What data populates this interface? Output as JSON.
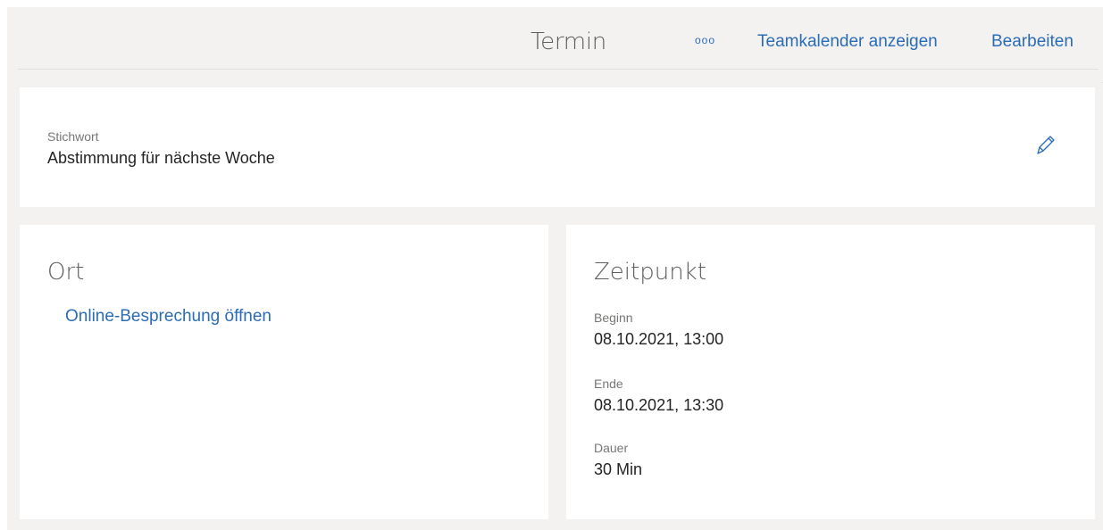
{
  "header": {
    "title": "Termin",
    "more_label": "ooo",
    "team_calendar_label": "Teamkalender anzeigen",
    "edit_label": "Bearbeiten"
  },
  "subject": {
    "label": "Stichwort",
    "value": "Abstimmung für nächste Woche",
    "edit_icon": "pencil-icon"
  },
  "place": {
    "title": "Ort",
    "online_meeting_link": "Online-Besprechung öffnen"
  },
  "time": {
    "title": "Zeitpunkt",
    "start": {
      "label": "Beginn",
      "value": "08.10.2021, 13:00"
    },
    "end": {
      "label": "Ende",
      "value": "08.10.2021, 13:30"
    },
    "duration": {
      "label": "Dauer",
      "value": "30 Min"
    }
  },
  "colors": {
    "accent": "#2b6cb6",
    "background": "#f3f2f1",
    "card": "#ffffff"
  }
}
